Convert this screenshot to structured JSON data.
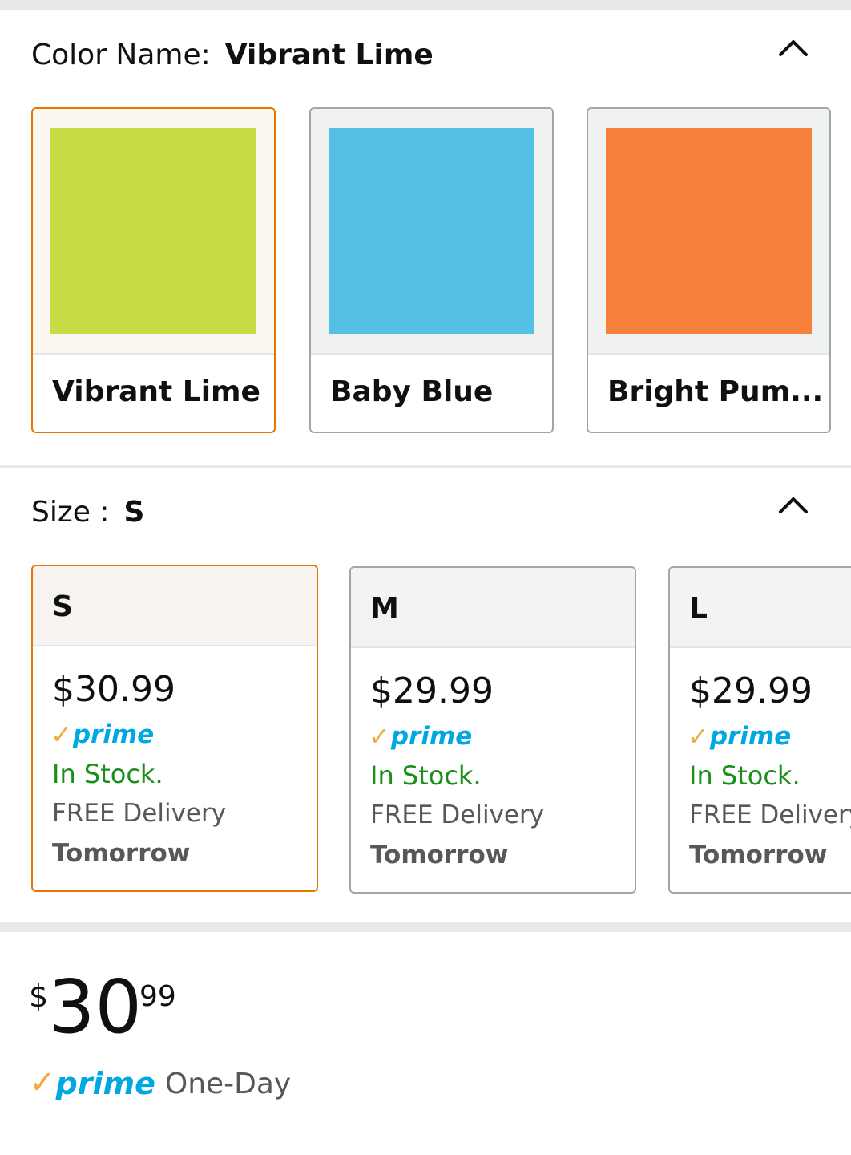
{
  "color_section": {
    "label": "Color Name:",
    "selected": "Vibrant Lime",
    "options": [
      {
        "name": "Vibrant Lime",
        "swatch": "#c7dc45"
      },
      {
        "name": "Baby Blue",
        "swatch": "#55c0e5"
      },
      {
        "name": "Bright Pum...",
        "swatch": "#f5813a"
      }
    ]
  },
  "size_section": {
    "label": "Size :",
    "selected": "S",
    "options": [
      {
        "size": "S",
        "price": "$30.99",
        "prime": "prime",
        "stock": "In Stock.",
        "delivery": "FREE Delivery",
        "when": "Tomorrow"
      },
      {
        "size": "M",
        "price": "$29.99",
        "prime": "prime",
        "stock": "In Stock.",
        "delivery": "FREE Delivery",
        "when": "Tomorrow"
      },
      {
        "size": "L",
        "price": "$29.99",
        "prime": "prime",
        "stock": "In Stock.",
        "delivery": "FREE Delivery",
        "when": "Tomorrow"
      }
    ]
  },
  "price_block": {
    "symbol": "$",
    "whole": "30",
    "fraction": "99",
    "prime": "prime",
    "shipping": "One-Day"
  },
  "icons": {
    "collapse": "chevron-up-icon",
    "prime_check": "check-icon"
  },
  "colors": {
    "selected_border": "#e77600",
    "in_stock": "#1a8f1a",
    "prime_blue": "#00a8e1",
    "prime_check": "#f3a847"
  }
}
